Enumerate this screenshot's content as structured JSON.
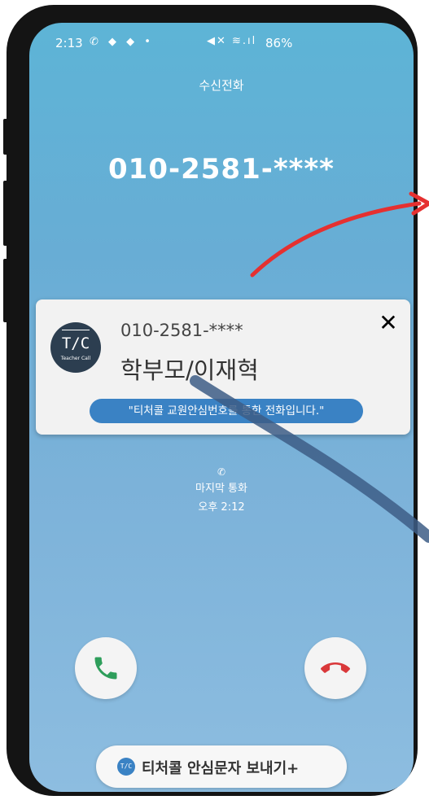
{
  "status_bar": {
    "time": "2:13",
    "left_icons": "✆ ◆ ◆ •",
    "right_icons": "◀✕ ≋.ıl",
    "battery": "86%"
  },
  "call": {
    "incoming_label": "수신전화",
    "number": "010-2581-****"
  },
  "popup": {
    "logo_text": "T/C",
    "logo_sub": "Teacher Call",
    "number": "010-2581-****",
    "name": "학부모/이재혁",
    "close_glyph": "✕",
    "notice": "\"티처콜 교원안심번호를 통한 전화입니다.\""
  },
  "last_call": {
    "icon_glyph": "✆",
    "label": "마지막 통화",
    "time": "오후 2:12"
  },
  "actions": {
    "accept_color": "#2e9e5b",
    "decline_color": "#d9383a"
  },
  "sms": {
    "icon_text": "T/C",
    "label": "티처콜 안심문자 보내기+"
  },
  "colors": {
    "screen_top": "#5db4d6",
    "screen_bottom": "#8dbde0",
    "popup_bg": "#f2f2f2",
    "notice_bg": "#3a82c4",
    "annotation_red": "#e53030",
    "annotation_blue": "#3d5d86"
  }
}
